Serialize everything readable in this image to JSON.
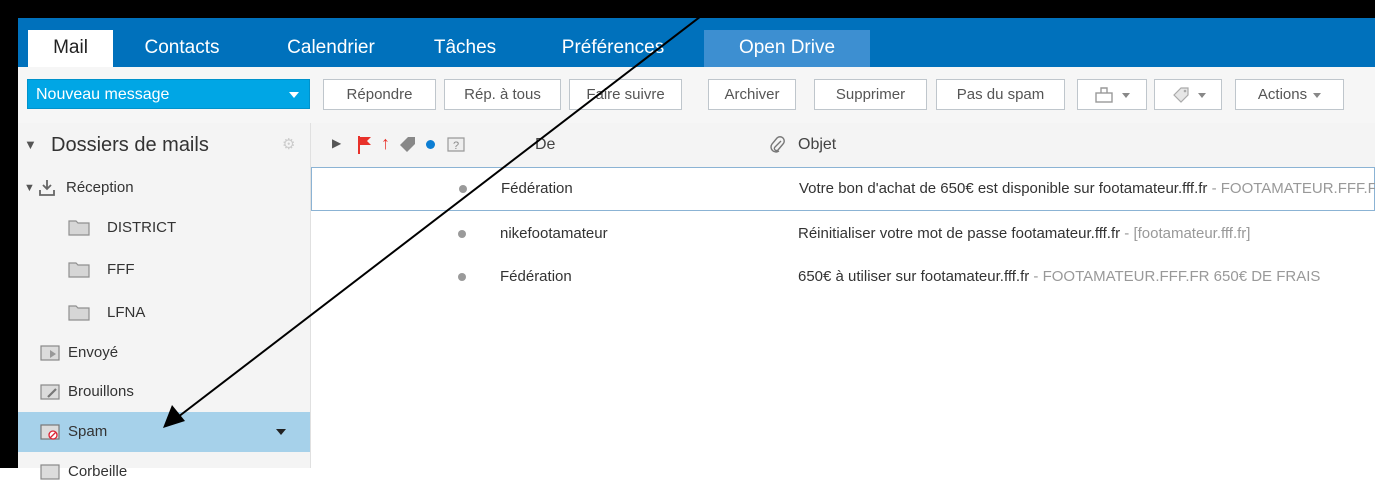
{
  "tabs": [
    {
      "label": "Mail",
      "active": true
    },
    {
      "label": "Contacts"
    },
    {
      "label": "Calendrier"
    },
    {
      "label": "Tâches"
    },
    {
      "label": "Préférences"
    },
    {
      "label": "Open Drive"
    }
  ],
  "toolbar": {
    "new_message": "Nouveau message",
    "reply": "Répondre",
    "reply_all": "Rép. à tous",
    "forward": "Faire suivre",
    "archive": "Archiver",
    "delete": "Supprimer",
    "not_spam": "Pas du spam",
    "actions": "Actions"
  },
  "sidebar": {
    "header": "Dossiers de mails",
    "folders": [
      {
        "label": "Réception",
        "icon": "inbox-icon",
        "expanded": true
      },
      {
        "label": "DISTRICT",
        "icon": "folder-icon"
      },
      {
        "label": "FFF",
        "icon": "folder-icon"
      },
      {
        "label": "LFNA",
        "icon": "folder-icon"
      },
      {
        "label": "Envoyé",
        "icon": "sent-icon"
      },
      {
        "label": "Brouillons",
        "icon": "drafts-icon"
      },
      {
        "label": "Spam",
        "icon": "spam-icon",
        "active": true
      },
      {
        "label": "Corbeille",
        "icon": "trash-icon"
      }
    ]
  },
  "list": {
    "columns": {
      "from": "De",
      "subject": "Objet"
    },
    "messages": [
      {
        "from": "Fédération",
        "subject": "Votre bon d'achat de 650€ est disponible sur footamateur.fff.fr",
        "preview": " - FOOTAMATEUR.FFF.FR",
        "selected": true
      },
      {
        "from": "nikefootamateur",
        "subject": "Réinitialiser votre mot de passe footamateur.fff.fr",
        "preview": " - [footamateur.fff.fr]"
      },
      {
        "from": "Fédération",
        "subject": "650€ à utiliser sur footamateur.fff.fr",
        "preview": " - FOOTAMATEUR.FFF.FR 650€ DE FRAIS"
      }
    ]
  },
  "colors": {
    "tab_bar": "#0071bc",
    "new_message_button": "#00a6e5",
    "active_folder": "#a6d1ea",
    "flag": "#e8312a",
    "unread_dot": "#0d7ed3"
  }
}
